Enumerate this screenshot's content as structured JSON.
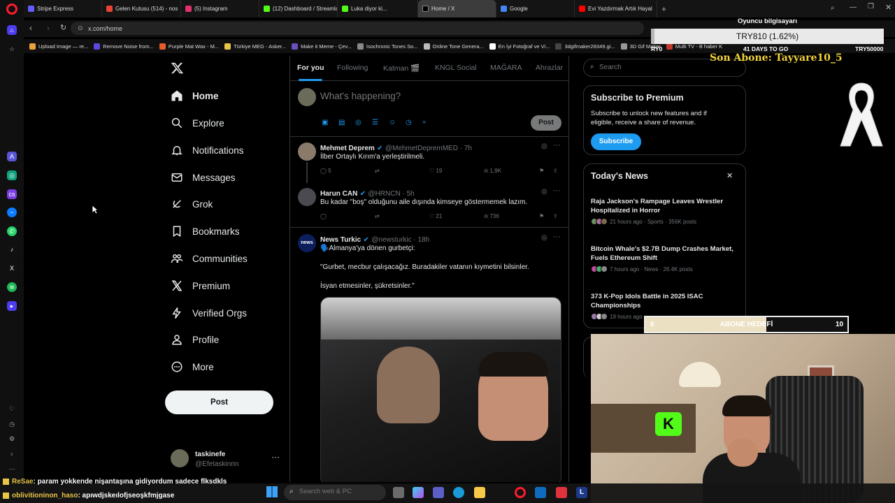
{
  "browser": {
    "tabs": [
      {
        "label": "Stripe Express",
        "color": "#635bff"
      },
      {
        "label": "Gelen Kutusu (514) - nos",
        "color": "#ea4335"
      },
      {
        "label": "(5) Instagram",
        "color": "#e1306c"
      },
      {
        "label": "(12) Dashboard / Streamla",
        "color": "#53fc18"
      },
      {
        "label": "Luka diyor ki...",
        "color": "#53fc18"
      },
      {
        "label": "Home / X",
        "color": "#000000",
        "active": true
      },
      {
        "label": "Google",
        "color": "#4285f4"
      },
      {
        "label": "Evi Yazdırmak Artık Hayal",
        "color": "#ff0000"
      }
    ],
    "new_tab_label": "+",
    "url": "x.com/home",
    "bookmarks": [
      {
        "label": "Upload Image — re...",
        "color": "#e8a33d"
      },
      {
        "label": "Remove Noise from...",
        "color": "#5b4ad9"
      },
      {
        "label": "Purple Mat Wax - M...",
        "color": "#e55d2b"
      },
      {
        "label": "Türkiye MEG - Asker...",
        "color": "#e8c547"
      },
      {
        "label": "Make it Meme - Çev...",
        "color": "#6a4fbf"
      },
      {
        "label": "Isochronic Tones So...",
        "color": "#888888"
      },
      {
        "label": "Online Tone Genera...",
        "color": "#bbbbbb"
      },
      {
        "label": "En İyi Fotoğraf ve Vi...",
        "color": "#ffffff"
      },
      {
        "label": "3dgifmaker28349.gi...",
        "color": "#444444"
      },
      {
        "label": "3D Gif Maker",
        "color": "#999999"
      },
      {
        "label": "Multi TV - B haber K",
        "color": "#c0392b"
      }
    ]
  },
  "x": {
    "nav": [
      {
        "label": "Home",
        "icon": "home-icon",
        "bold": true
      },
      {
        "label": "Explore",
        "icon": "search-icon"
      },
      {
        "label": "Notifications",
        "icon": "bell-icon"
      },
      {
        "label": "Messages",
        "icon": "mail-icon"
      },
      {
        "label": "Grok",
        "icon": "grok-icon"
      },
      {
        "label": "Bookmarks",
        "icon": "bookmark-icon"
      },
      {
        "label": "Communities",
        "icon": "people-icon"
      },
      {
        "label": "Premium",
        "icon": "x-logo-icon"
      },
      {
        "label": "Verified Orgs",
        "icon": "lightning-icon"
      },
      {
        "label": "Profile",
        "icon": "user-icon"
      },
      {
        "label": "More",
        "icon": "more-circle-icon"
      }
    ],
    "post_button": "Post",
    "account": {
      "name": "taskinefe",
      "handle": "@Efetaskinnn"
    },
    "feed_tabs": [
      "For you",
      "Following",
      "Katman 🎬",
      "KNGL Social",
      "MAĞARA",
      "Ahrazlar"
    ],
    "compose_placeholder": "What's happening?",
    "compose_post": "Post",
    "tweets": [
      {
        "name": "Mehmet Deprem",
        "handle": "@MehmetDepremMED",
        "time": "7h",
        "text": "İlber Ortaylı Kırım'a yerleştirilmeli.",
        "replies": "5",
        "likes": "19",
        "views": "1,9K",
        "avatar": "#8a7a6a"
      },
      {
        "name": "Harun CAN",
        "handle": "@HRNCN",
        "time": "5h",
        "text": "Bu kadar \"boş\" olduğunu aile dışında kimseye göstermemek lazım.",
        "replies": "",
        "likes": "21",
        "views": "736",
        "avatar": "#4a4a50"
      },
      {
        "name": "News Turkic",
        "handle": "@newsturkic",
        "time": "18h",
        "text": "🗣️Almanya'ya dönen gurbetçi:",
        "quote1": "\"Gurbet, mecbur çalışacağız. Buradakiler vatanın kıymetini bilsinler.",
        "quote2": "İsyan etmesinler, şükretsinler.\"",
        "avatar": "#0b1f5c",
        "avatar_label": "news"
      }
    ],
    "search_placeholder": "Search",
    "premium": {
      "title": "Subscribe to Premium",
      "text": "Subscribe to unlock new features and if eligible, receive a share of revenue.",
      "button": "Subscribe"
    },
    "news": {
      "title": "Today's News",
      "items": [
        {
          "title": "Raja Jackson's Rampage Leaves Wrestler Hospitalized in Horror",
          "meta": "21 hours ago · Sports · 356K posts"
        },
        {
          "title": "Bitcoin Whale's $2.7B Dump Crashes Market, Fuels Ethereum Shift",
          "meta": "7 hours ago · News · 26.4K posts"
        },
        {
          "title": "373 K-Pop Idols Battle in 2025 ISAC Championships",
          "meta": "19 hours ago"
        }
      ]
    }
  },
  "overlay": {
    "header": "Oyuncu bilgisayarı",
    "goal_value": "TRY810 (1.62%)",
    "goal_left": "RY0",
    "goal_days": "41 DAYS TO GO",
    "goal_right": "TRY50000",
    "goal_progress": 0.0162,
    "last_sub": "Son Abone: Tayyare10_5",
    "sub_goal_label": "ABONE HEDEFİ",
    "sub_goal_current": "6",
    "sub_goal_target": "10",
    "sub_goal_progress": 0.6
  },
  "chat": [
    {
      "user": "ReSae",
      "msg": ": param yokkende nişantaşına gidiyordum sadece flksdkls"
    },
    {
      "user": "oblivitioninon_haso",
      "msg": ": apıwdjskeılofjseoşkfmjgase"
    }
  ],
  "taskbar": {
    "search_placeholder": "Search web & PC"
  },
  "colors": {
    "x_blue": "#1d9bf0",
    "border": "#2f3336",
    "muted": "#71767b"
  }
}
